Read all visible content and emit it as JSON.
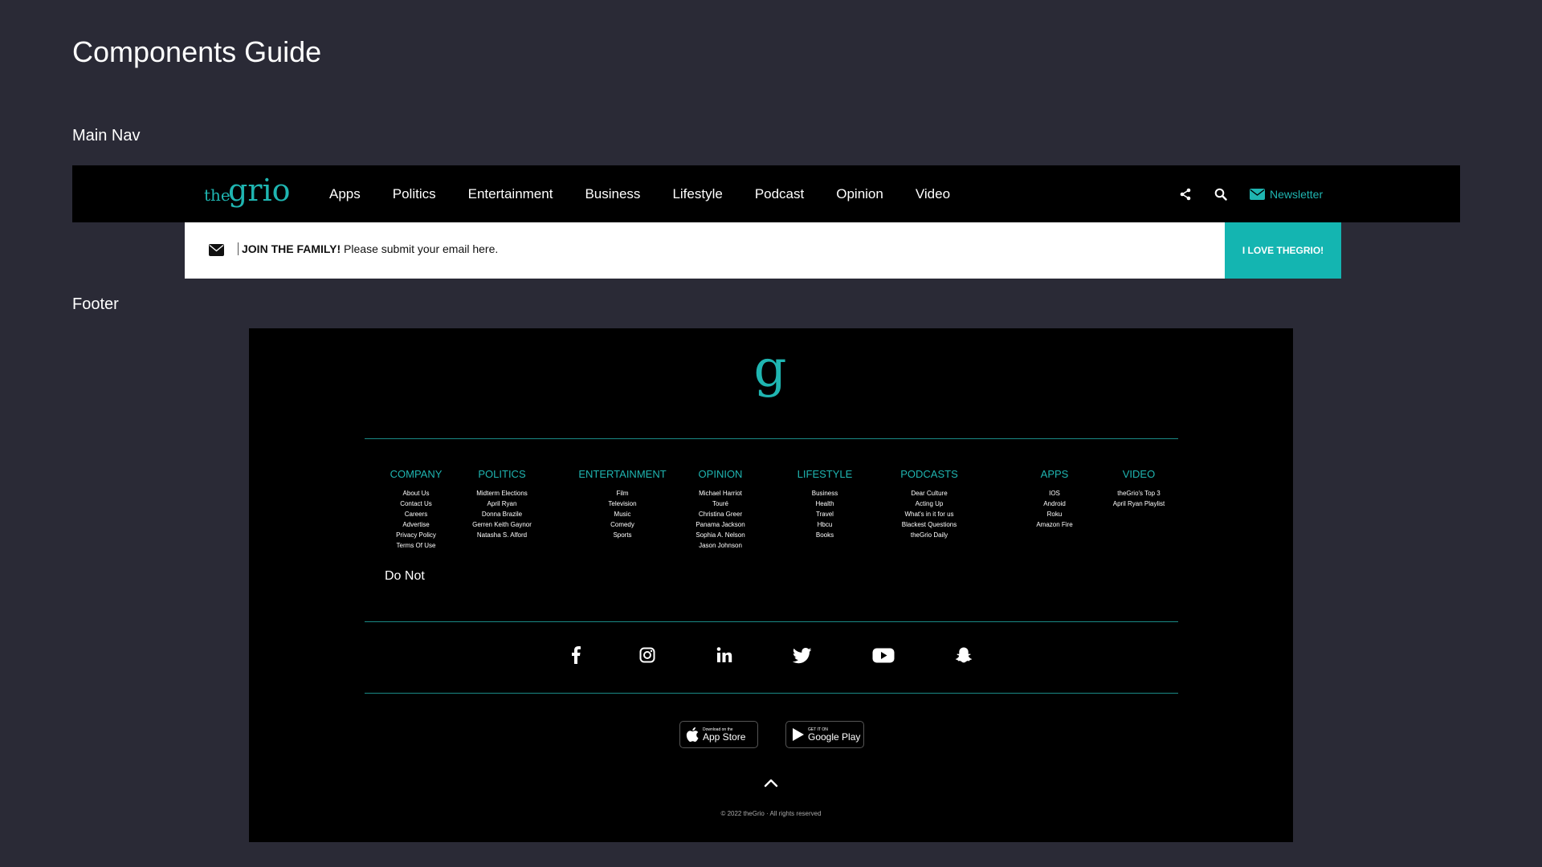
{
  "page": {
    "title": "Components Guide"
  },
  "sections": {
    "main_nav": "Main Nav",
    "footer": "Footer"
  },
  "nav": {
    "logo_small": "the",
    "logo_big": "grio",
    "links": [
      "Apps",
      "Politics",
      "Entertainment",
      "Business",
      "Lifestyle",
      "Podcast",
      "Opinion",
      "Video"
    ],
    "newsletter_label": "Newsletter",
    "icons": [
      "share-icon",
      "search-icon",
      "envelope-icon"
    ]
  },
  "join": {
    "strong": "JOIN THE FAMILY!",
    "text": " Please submit your email here.",
    "button": "I LOVE THEGRIO!"
  },
  "footer": {
    "logo_letter": "g",
    "columns": [
      {
        "title": "COMPANY",
        "items": [
          "About Us",
          "Contact Us",
          "Careers",
          "Advertise",
          "Privacy Policy",
          "Terms Of Use"
        ]
      },
      {
        "title": "POLITICS",
        "items": [
          "Midterm Elections",
          "April Ryan",
          "Donna Brazile",
          "Gerren Keith Gaynor",
          "Natasha S. Alford"
        ]
      },
      {
        "title": "ENTERTAINMENT",
        "items": [
          "Film",
          "Television",
          "Music",
          "Comedy",
          "Sports"
        ]
      },
      {
        "title": "OPINION",
        "items": [
          "Michael Harriot",
          "Touré",
          "Christina Greer",
          "Panama Jackson",
          "Sophia A. Nelson",
          "Jason Johnson"
        ]
      },
      {
        "title": "LIFESTYLE",
        "items": [
          "Business",
          "Health",
          "Travel",
          "Hbcu",
          "Books"
        ]
      },
      {
        "title": "PODCASTS",
        "items": [
          "Dear Culture",
          "Acting Up",
          "What's in it for us",
          "Blackest Questions",
          "theGrio Daily"
        ]
      },
      {
        "title": "APPS",
        "items": [
          "IOS",
          "Android",
          "Roku",
          "Amazon Fire"
        ]
      },
      {
        "title": "VIDEO",
        "items": [
          "theGrio's Top 3",
          "April Ryan Playlist"
        ]
      }
    ],
    "do_not": "Do Not",
    "social_icons": [
      "facebook-icon",
      "instagram-icon",
      "linkedin-icon",
      "twitter-icon",
      "youtube-icon",
      "snapchat-icon"
    ],
    "app_store": {
      "small": "Download on the",
      "big": "App Store"
    },
    "google_play": {
      "small": "GET IT ON",
      "big": "Google Play"
    },
    "copyright": "© 2022 theGrio · All rights reserved"
  },
  "colors": {
    "accent": "#14b5b1",
    "page_bg": "#2a2a36",
    "bar_bg": "#000000"
  }
}
